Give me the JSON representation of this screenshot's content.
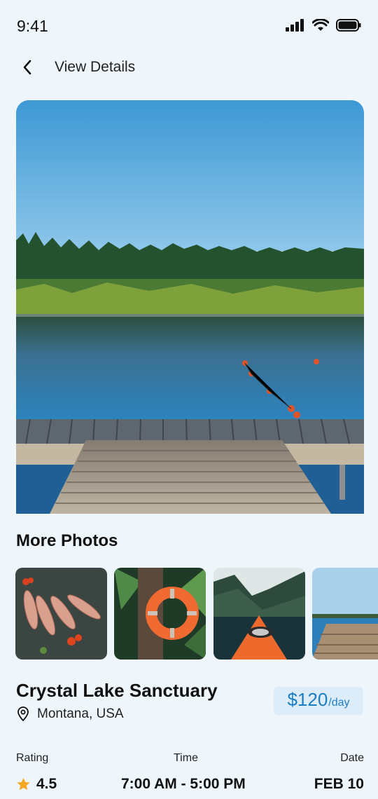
{
  "status_bar": {
    "time": "9:41"
  },
  "header": {
    "title": "View Details"
  },
  "section": {
    "more_photos": "More Photos"
  },
  "place": {
    "name": "Crystal Lake Sanctuary",
    "location": "Montana, USA",
    "price": "$120",
    "price_unit": "/day"
  },
  "info": {
    "rating_label": "Rating",
    "rating_value": "4.5",
    "time_label": "Time",
    "time_value": "7:00 AM - 5:00 PM",
    "date_label": "Date",
    "date_value": "FEB 10"
  },
  "icons": [
    "back-arrow-icon",
    "signal-icon",
    "wifi-icon",
    "battery-icon",
    "location-pin-icon",
    "star-icon"
  ],
  "colors": {
    "background": "#eef5fb",
    "accent": "#1c7ec4",
    "price_badge_bg": "#dcecf9",
    "star": "#f5a623"
  }
}
